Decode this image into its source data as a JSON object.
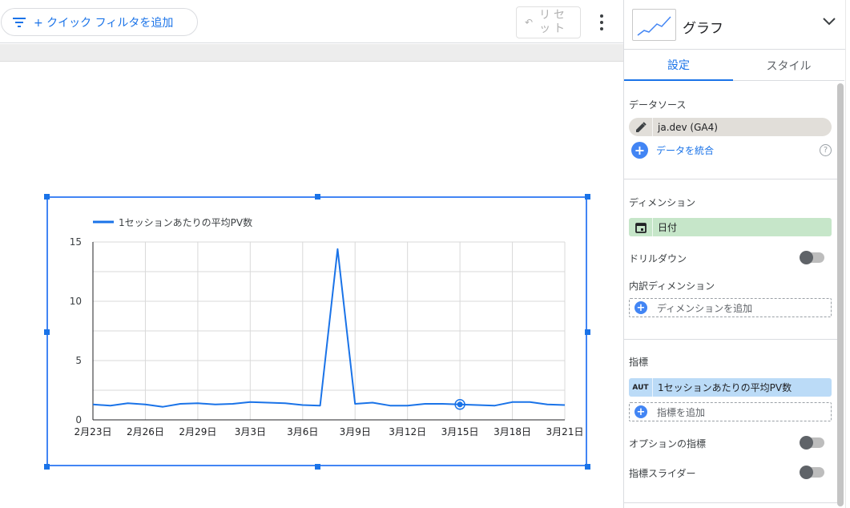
{
  "toolbar": {
    "filter_label": "+ クイック フィルタを追加",
    "reset_label": "リセット"
  },
  "panel": {
    "title": "グラフ",
    "tabs": [
      {
        "label": "設定",
        "active": true
      },
      {
        "label": "スタイル",
        "active": false
      }
    ],
    "datasource": {
      "heading": "データソース",
      "name": "ja.dev (GA4)",
      "blend_label": "データを統合"
    },
    "dimension": {
      "heading": "ディメンション",
      "value": "日付",
      "drilldown_label": "ドリルダウン",
      "drilldown_on": false,
      "breakdown_heading": "内訳ディメンション",
      "add_label": "ディメンションを追加"
    },
    "metric": {
      "heading": "指標",
      "type_badge": "AUT",
      "value": "1セッションあたりの平均PV数",
      "add_label": "指標を追加",
      "optional_label": "オプションの指標",
      "optional_on": false,
      "slider_label": "指標スライダー",
      "slider_on": false
    }
  },
  "chart_data": {
    "type": "line",
    "legend": [
      "1セッションあたりの平均PV数"
    ],
    "legend_position": "top-left",
    "grid": true,
    "ylim": [
      0,
      15
    ],
    "y_ticks": [
      "0",
      "5",
      "10",
      "15"
    ],
    "x_ticks": [
      "2月23日",
      "2月26日",
      "2月29日",
      "3月3日",
      "3月6日",
      "3月9日",
      "3月12日",
      "3月15日",
      "3月18日",
      "3月21日"
    ],
    "x_range": [
      "2月23日",
      "3月21日"
    ],
    "series": [
      {
        "name": "1セッションあたりの平均PV数",
        "color": "#1a73e8",
        "x": [
          "2月23日",
          "2月24日",
          "2月25日",
          "2月26日",
          "2月27日",
          "2月28日",
          "2月29日",
          "3月1日",
          "3月2日",
          "3月3日",
          "3月4日",
          "3月5日",
          "3月6日",
          "3月7日",
          "3月8日",
          "3月9日",
          "3月10日",
          "3月11日",
          "3月12日",
          "3月13日",
          "3月14日",
          "3月15日",
          "3月16日",
          "3月17日",
          "3月18日",
          "3月19日",
          "3月20日",
          "3月21日"
        ],
        "values": [
          1.3,
          1.2,
          1.4,
          1.3,
          1.1,
          1.35,
          1.4,
          1.3,
          1.35,
          1.5,
          1.45,
          1.4,
          1.25,
          1.2,
          14.4,
          1.35,
          1.45,
          1.2,
          1.2,
          1.35,
          1.35,
          1.3,
          1.25,
          1.2,
          1.5,
          1.5,
          1.3,
          1.25
        ]
      }
    ],
    "highlight": "3月15日"
  },
  "colors": {
    "accent": "#1a73e8",
    "selection": "#4285f4",
    "dimension_chip": "#c6e6c9",
    "metric_chip": "#bbdbf7"
  }
}
